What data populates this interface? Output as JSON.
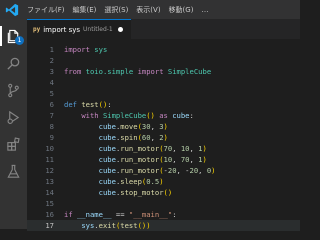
{
  "menu": [
    "ファイル(F)",
    "編集(E)",
    "選択(S)",
    "表示(V)",
    "移動(G)",
    "…"
  ],
  "activity_badge": "1",
  "tab": {
    "icon": "py",
    "name": "import sys",
    "subtitle": "Untitled-1"
  },
  "code_lines": [
    {
      "n": "1",
      "tokens": [
        [
          "k",
          "import"
        ],
        [
          "t",
          " "
        ],
        [
          "c",
          "sys"
        ]
      ]
    },
    {
      "n": "2",
      "tokens": []
    },
    {
      "n": "3",
      "tokens": [
        [
          "k",
          "from"
        ],
        [
          "t",
          " "
        ],
        [
          "c",
          "toio.simple"
        ],
        [
          "t",
          " "
        ],
        [
          "k",
          "import"
        ],
        [
          "t",
          " "
        ],
        [
          "c",
          "SimpleCube"
        ]
      ]
    },
    {
      "n": "4",
      "tokens": []
    },
    {
      "n": "5",
      "tokens": []
    },
    {
      "n": "6",
      "tokens": [
        [
          "d",
          "def"
        ],
        [
          "t",
          " "
        ],
        [
          "f",
          "test"
        ],
        [
          "y",
          "()"
        ],
        [
          "t",
          ":"
        ]
      ]
    },
    {
      "n": "7",
      "tokens": [
        [
          "t",
          "    "
        ],
        [
          "k",
          "with"
        ],
        [
          "t",
          " "
        ],
        [
          "c",
          "SimpleCube"
        ],
        [
          "y",
          "()"
        ],
        [
          "t",
          " "
        ],
        [
          "k",
          "as"
        ],
        [
          "t",
          " "
        ],
        [
          "v",
          "cube"
        ],
        [
          "t",
          ":"
        ]
      ]
    },
    {
      "n": "8",
      "tokens": [
        [
          "t",
          "        "
        ],
        [
          "v",
          "cube"
        ],
        [
          "t",
          "."
        ],
        [
          "f",
          "move"
        ],
        [
          "y",
          "("
        ],
        [
          "n",
          "30"
        ],
        [
          "t",
          ", "
        ],
        [
          "n",
          "3"
        ],
        [
          "y",
          ")"
        ]
      ]
    },
    {
      "n": "9",
      "tokens": [
        [
          "t",
          "        "
        ],
        [
          "v",
          "cube"
        ],
        [
          "t",
          "."
        ],
        [
          "f",
          "spin"
        ],
        [
          "y",
          "("
        ],
        [
          "n",
          "60"
        ],
        [
          "t",
          ", "
        ],
        [
          "n",
          "2"
        ],
        [
          "y",
          ")"
        ]
      ]
    },
    {
      "n": "10",
      "tokens": [
        [
          "t",
          "        "
        ],
        [
          "v",
          "cube"
        ],
        [
          "t",
          "."
        ],
        [
          "f",
          "run_motor"
        ],
        [
          "y",
          "("
        ],
        [
          "n",
          "70"
        ],
        [
          "t",
          ", "
        ],
        [
          "n",
          "10"
        ],
        [
          "t",
          ", "
        ],
        [
          "n",
          "1"
        ],
        [
          "y",
          ")"
        ]
      ]
    },
    {
      "n": "11",
      "tokens": [
        [
          "t",
          "        "
        ],
        [
          "v",
          "cube"
        ],
        [
          "t",
          "."
        ],
        [
          "f",
          "run_motor"
        ],
        [
          "y",
          "("
        ],
        [
          "n",
          "10"
        ],
        [
          "t",
          ", "
        ],
        [
          "n",
          "70"
        ],
        [
          "t",
          ", "
        ],
        [
          "n",
          "1"
        ],
        [
          "y",
          ")"
        ]
      ]
    },
    {
      "n": "12",
      "tokens": [
        [
          "t",
          "        "
        ],
        [
          "v",
          "cube"
        ],
        [
          "t",
          "."
        ],
        [
          "f",
          "run_motor"
        ],
        [
          "y",
          "("
        ],
        [
          "t",
          "-"
        ],
        [
          "n",
          "20"
        ],
        [
          "t",
          ", -"
        ],
        [
          "n",
          "20"
        ],
        [
          "t",
          ", "
        ],
        [
          "n",
          "0"
        ],
        [
          "y",
          ")"
        ]
      ]
    },
    {
      "n": "13",
      "tokens": [
        [
          "t",
          "        "
        ],
        [
          "v",
          "cube"
        ],
        [
          "t",
          "."
        ],
        [
          "f",
          "sleep"
        ],
        [
          "y",
          "("
        ],
        [
          "n",
          "0.5"
        ],
        [
          "y",
          ")"
        ]
      ]
    },
    {
      "n": "14",
      "tokens": [
        [
          "t",
          "        "
        ],
        [
          "v",
          "cube"
        ],
        [
          "t",
          "."
        ],
        [
          "f",
          "stop_motor"
        ],
        [
          "y",
          "()"
        ]
      ]
    },
    {
      "n": "15",
      "tokens": []
    },
    {
      "n": "16",
      "tokens": [
        [
          "k",
          "if"
        ],
        [
          "t",
          " "
        ],
        [
          "v",
          "__name__"
        ],
        [
          "t",
          " == "
        ],
        [
          "s",
          "\"__main__\""
        ],
        [
          "t",
          ":"
        ]
      ]
    },
    {
      "n": "17",
      "tokens": [
        [
          "t",
          "    "
        ],
        [
          "v",
          "sys"
        ],
        [
          "t",
          "."
        ],
        [
          "f",
          "exit"
        ],
        [
          "y",
          "("
        ],
        [
          "f",
          "test"
        ],
        [
          "y",
          "())"
        ]
      ]
    }
  ],
  "current_line": "17"
}
